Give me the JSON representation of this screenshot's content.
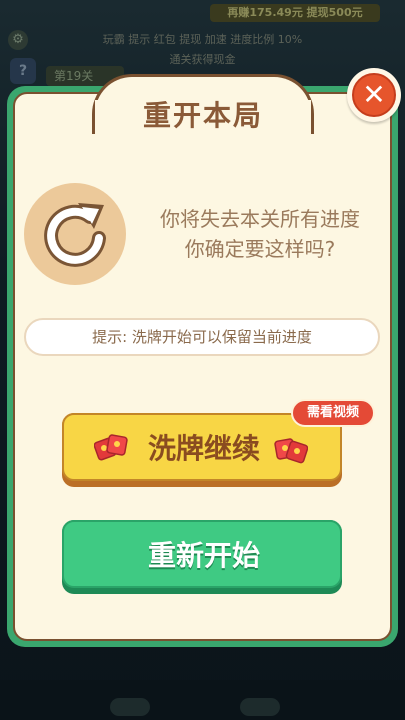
{
  "background": {
    "top_bar_text": "再赚175.49元 提现500元",
    "line1_text": "玩霸 提示 红包 提现 加速 进度比例 10%",
    "line2_text": "通关获得现金",
    "level_text": "第19关",
    "help_glyph": "?",
    "gear_glyph": "⚙"
  },
  "dialog": {
    "title": "重开本局",
    "message_line1": "你将失去本关所有进度",
    "message_line2": "你确定要这样吗?",
    "hint": "提示: 洗牌开始可以保留当前进度",
    "shuffle_button_label": "洗牌继续",
    "video_badge": "需看视频",
    "restart_button_label": "重新开始",
    "close_glyph": "✕"
  },
  "colors": {
    "dialog_border": "#3aa66e",
    "dialog_bg": "#fdf7e2",
    "title_text": "#8a5a37",
    "shuffle_button": "#f8d645",
    "restart_button": "#3fca83",
    "close_button": "#e6552c",
    "video_badge": "#e44a36"
  },
  "icons": {
    "restart": "restart-arrow-icon",
    "close": "close-icon",
    "red_envelope": "red-envelope-icon"
  }
}
